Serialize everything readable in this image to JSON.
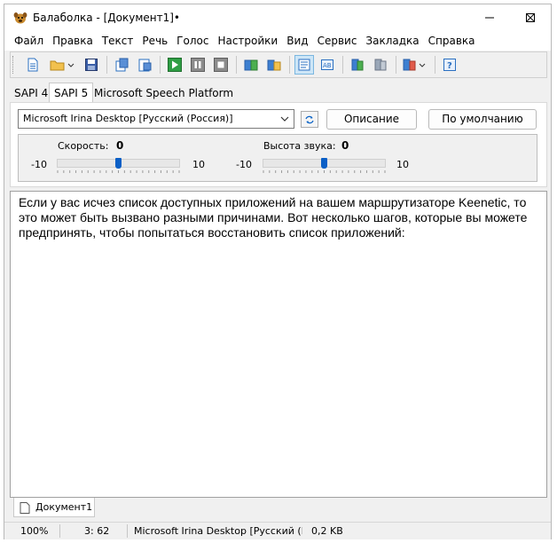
{
  "window": {
    "title": "Балаболка - [Документ1]•"
  },
  "menu": [
    "Файл",
    "Правка",
    "Текст",
    "Речь",
    "Голос",
    "Настройки",
    "Вид",
    "Сервис",
    "Закладка",
    "Справка"
  ],
  "toolbar": {
    "buttons": [
      "new-document-icon",
      "open-folder-icon",
      "save-icon",
      "read-clipboard-icon",
      "read-file-icon",
      "play-icon",
      "pause-icon",
      "stop-icon",
      "export-audio-icon",
      "batch-convert-icon",
      "text-view-icon",
      "subtitle-icon",
      "translate-icon",
      "dictionary-icon",
      "spellcheck-icon",
      "help-icon"
    ]
  },
  "tabs": {
    "items": [
      "SAPI 4",
      "SAPI 5",
      "Microsoft Speech Platform"
    ],
    "selected": "SAPI 5"
  },
  "voice": {
    "selected": "Microsoft Irina Desktop [Русский (Россия)]",
    "description_button": "Описание",
    "default_button": "По умолчанию"
  },
  "rate": {
    "label": "Скорость:",
    "value": "0",
    "min": "-10",
    "max": "10",
    "level": 0.5
  },
  "pitch": {
    "label": "Высота звука:",
    "value": "0",
    "min": "-10",
    "max": "10",
    "level": 0.5
  },
  "editor": {
    "text": "Если у вас исчез список доступных приложений на вашем маршрутизаторе Keenetic, то это может быть вызвано разными причинами. Вот несколько шагов, которые вы можете предпринять, чтобы попытаться восстановить список приложений:"
  },
  "document_tab": {
    "label": "Документ1"
  },
  "statusbar": {
    "zoom": "100%",
    "position": "3:  62",
    "voice": "Microsoft Irina Desktop [Русский (Ро",
    "size": "0,2 KB"
  },
  "colors": {
    "accent": "#0a5fc6",
    "window_bg": "#f0f0f0",
    "active_button": "#cde6f7"
  }
}
